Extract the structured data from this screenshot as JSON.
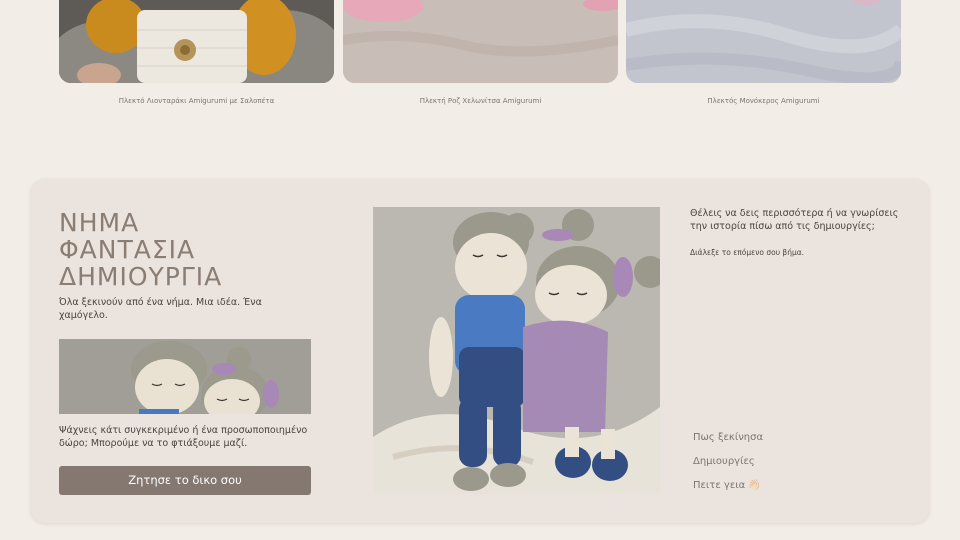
{
  "products": [
    {
      "caption": "Πλεκτό Λιονταράκι Amigurumi με Σαλοπέτα",
      "photo_icon": "lion-doll-photo"
    },
    {
      "caption": "Πλεκτή Ροζ Χελωνίτσα Amigurumi",
      "photo_icon": "pink-turtle-photo"
    },
    {
      "caption": "Πλεκτός Μονόκερος Amigurumi",
      "photo_icon": "unicorn-photo"
    }
  ],
  "story": {
    "brand_lines": [
      "ΝΗΜΑ",
      "ΦΑΝΤΑΣΙΑ",
      "ΔΗΜΙΟΥΡΓΙΑ"
    ],
    "tagline": "Όλα ξεκινούν από ένα νήμα. Μια ιδέα. Ένα χαμόγελο.",
    "prompt": "Ψάχνεις κάτι συγκεκριμένο ή ένα προσωποποιημένο δώρο; Μπορούμε να το φτιάξουμε μαζί.",
    "cta_label": "Ζητησε το δικο σου",
    "question": "Θέλεις να δεις περισσότερα ή να γνωρίσεις την ιστορία πίσω από τις δημιουργίες;",
    "step_hint": "Διάλεξε το επόμενο σου βήμα.",
    "nav": [
      "Πως ξεκίνησα",
      "Δημιουργίες",
      "Πειτε γεια 👋🏻"
    ]
  },
  "colors": {
    "page_bg": "#f3ede8",
    "card_bg": "#ebe3dd",
    "brand": "#8a7d73",
    "cta_bg": "#847870"
  }
}
